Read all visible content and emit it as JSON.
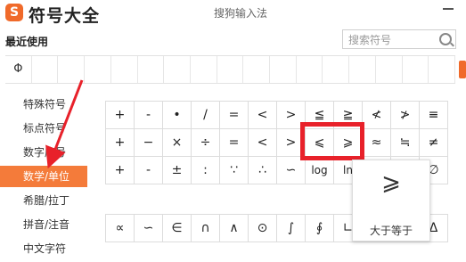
{
  "header": {
    "logo": "S",
    "app_title": "符号大全",
    "window_title": "搜狗输入法"
  },
  "recent": {
    "label": "最近使用",
    "symbols": [
      "Φ",
      "",
      "",
      "",
      "",
      "",
      "",
      "",
      "",
      "",
      "",
      "",
      "",
      "",
      "",
      "",
      ""
    ]
  },
  "search": {
    "placeholder": "搜索符号"
  },
  "sidebar": {
    "items": [
      {
        "label": "特殊符号"
      },
      {
        "label": "标点符号"
      },
      {
        "label": "数字序号"
      },
      {
        "label": "数学/单位",
        "active": true
      },
      {
        "label": "希腊/拉丁"
      },
      {
        "label": "拼音/注音"
      },
      {
        "label": "中文字符"
      }
    ]
  },
  "symbol_grid": {
    "rows": [
      [
        "+",
        "-",
        "•",
        "/",
        "=",
        "<",
        ">",
        "≦",
        "≧",
        "≮",
        "≯",
        "≡"
      ],
      [
        "+",
        "−",
        "×",
        "÷",
        "=",
        "<",
        ">",
        "⩽",
        "⩾",
        "≈",
        "≒",
        "≠"
      ],
      [
        "+",
        "-",
        "±",
        ":",
        "∵",
        "∴",
        "∽",
        "log",
        "ln",
        "",
        "",
        "∅"
      ]
    ]
  },
  "symbol_grid2": {
    "rows": [
      [
        "∝",
        "∽",
        "∈",
        "∩",
        "∧",
        "⊙",
        "∫",
        "∮",
        "∟",
        "",
        "",
        "Δ"
      ]
    ]
  },
  "tooltip": {
    "symbol": "⩾",
    "name": "大于等于"
  },
  "colors": {
    "accent": "#f47b3a",
    "highlight_border": "#e8212a"
  }
}
